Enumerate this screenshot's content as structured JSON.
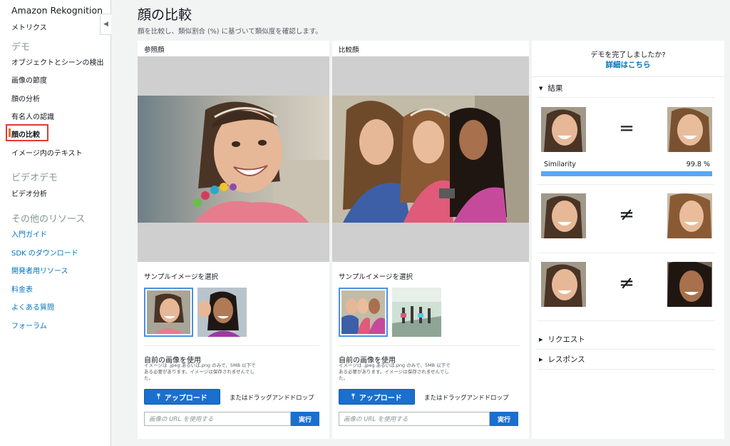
{
  "sidebar": {
    "title": "Amazon Rekognition",
    "metrics": "メトリクス",
    "demo_section": "デモ",
    "demo_items": [
      "オブジェクトとシーンの検出",
      "画像の節度",
      "顔の分析",
      "有名人の認識",
      "顔の比較",
      "イメージ内のテキスト"
    ],
    "video_section": "ビデオデモ",
    "video_items": [
      "ビデオ分析"
    ],
    "resources_section": "その他のリソース",
    "resource_links": [
      "入門ガイド",
      "SDK のダウンロード",
      "開発者用リソース",
      "料金表",
      "よくある質問",
      "フォーラム"
    ],
    "collapse_icon": "chevron-left-icon"
  },
  "header": {
    "title": "顔の比較",
    "description": "顔を比較し、類似割合 (%) に基づいて類似度を確認します。"
  },
  "reference": {
    "label": "参照顔",
    "sample_label": "サンプルイメージを選択",
    "own_title": "自前の画像を使用",
    "own_desc": "イメージは .jpeg あるいは.png のみで、5MB 以下である必要があります。イメージは保存されませんでした。",
    "upload_label": "アップロード",
    "drag_label": "またはドラッグアンドドロップ",
    "url_placeholder": "画像の URL を使用する",
    "go_label": "実行"
  },
  "comparison": {
    "label": "比較顔",
    "sample_label": "サンプルイメージを選択",
    "own_title": "自前の画像を使用",
    "own_desc": "イメージは .jpeg あるいは.png のみで、5MB 以下である必要があります。イメージは保存されませんでした。",
    "upload_label": "アップロード",
    "drag_label": "またはドラッグアンドドロップ",
    "url_placeholder": "画像の URL を使用する",
    "go_label": "実行"
  },
  "results": {
    "done_question": "デモを完了しましたか?",
    "details_link": "詳細はこちら",
    "results_label": "結果",
    "match_symbol": "=",
    "nonmatch_symbol": "≠",
    "similarity_label": "Similarity",
    "similarity_value": "99.8 %",
    "similarity_fraction": 0.998,
    "request_label": "リクエスト",
    "response_label": "レスポンス"
  },
  "colors": {
    "link": "#0073bb",
    "primary_button": "#1a6fcf",
    "similarity_bar": "#59a7f3",
    "active_highlight": "#e53935"
  }
}
